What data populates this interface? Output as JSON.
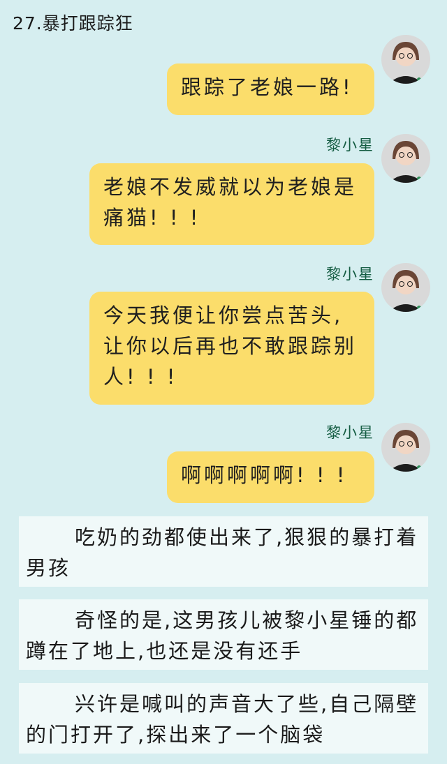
{
  "header": {
    "title": "27.暴打跟踪狂"
  },
  "messages": [
    {
      "sender": "",
      "text": "跟踪了老娘一路!"
    },
    {
      "sender": "黎小星",
      "text": "老娘不发威就以为老娘是痛猫! ! !"
    },
    {
      "sender": "黎小星",
      "text": "今天我便让你尝点苦头,让你以后再也不敢跟踪别人! ! !"
    },
    {
      "sender": "黎小星",
      "text": "啊啊啊啊啊! ! !"
    }
  ],
  "narration": [
    "吃奶的劲都使出来了,狠狠的暴打着男孩",
    "奇怪的是,这男孩儿被黎小星锤的都蹲在了地上,也还是没有还手",
    "兴许是喊叫的声音大了些,自己隔壁的门打开了,探出来了一个脑袋"
  ],
  "colors": {
    "background": "#d6eef0",
    "bubble": "#fbdd6b",
    "name": "#145c42",
    "narration_box": "#f0f9f9"
  },
  "icons": {
    "avatar": "avatar-photo"
  }
}
